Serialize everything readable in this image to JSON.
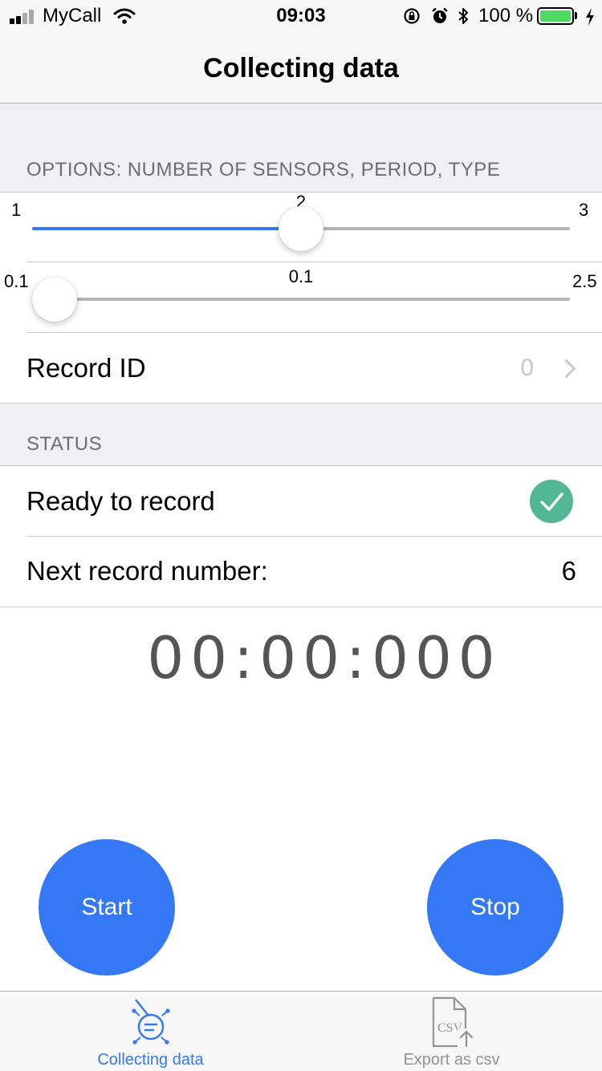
{
  "status_bar": {
    "carrier": "MyCall",
    "time": "09:03",
    "battery_text": "100 %",
    "battery_level": 1.0,
    "icons": [
      "signal-icon",
      "wifi-icon",
      "rotation-lock-icon",
      "alarm-icon",
      "bluetooth-icon",
      "battery-icon",
      "charging-icon"
    ]
  },
  "nav": {
    "title": "Collecting data"
  },
  "options": {
    "header": "OPTIONS: NUMBER OF SENSORS, PERIOD, TYPE",
    "sensors_slider": {
      "min": "1",
      "max": "3",
      "value_label": "2",
      "value": 2,
      "min_value": 1,
      "max_value": 3
    },
    "period_slider": {
      "min": "0.1",
      "max": "2.5",
      "value_label": "0.1",
      "value": 0.1,
      "min_value": 0.1,
      "max_value": 2.5
    },
    "record_id": {
      "label": "Record ID",
      "value": "0"
    }
  },
  "status": {
    "header": "STATUS",
    "ready_label": "Ready to record",
    "next_record_label": "Next record number:",
    "next_record_value": "6"
  },
  "timer": "00:00:000",
  "buttons": {
    "start": "Start",
    "stop": "Stop"
  },
  "tabs": [
    {
      "label": "Collecting data",
      "icon": "sensor-icon",
      "active": true
    },
    {
      "label": "Export as csv",
      "icon": "csv-export-icon",
      "active": false
    }
  ],
  "colors": {
    "accent": "#3478f6",
    "success": "#52b795",
    "group_background": "#efeff4",
    "inactive_tab": "#929292"
  }
}
